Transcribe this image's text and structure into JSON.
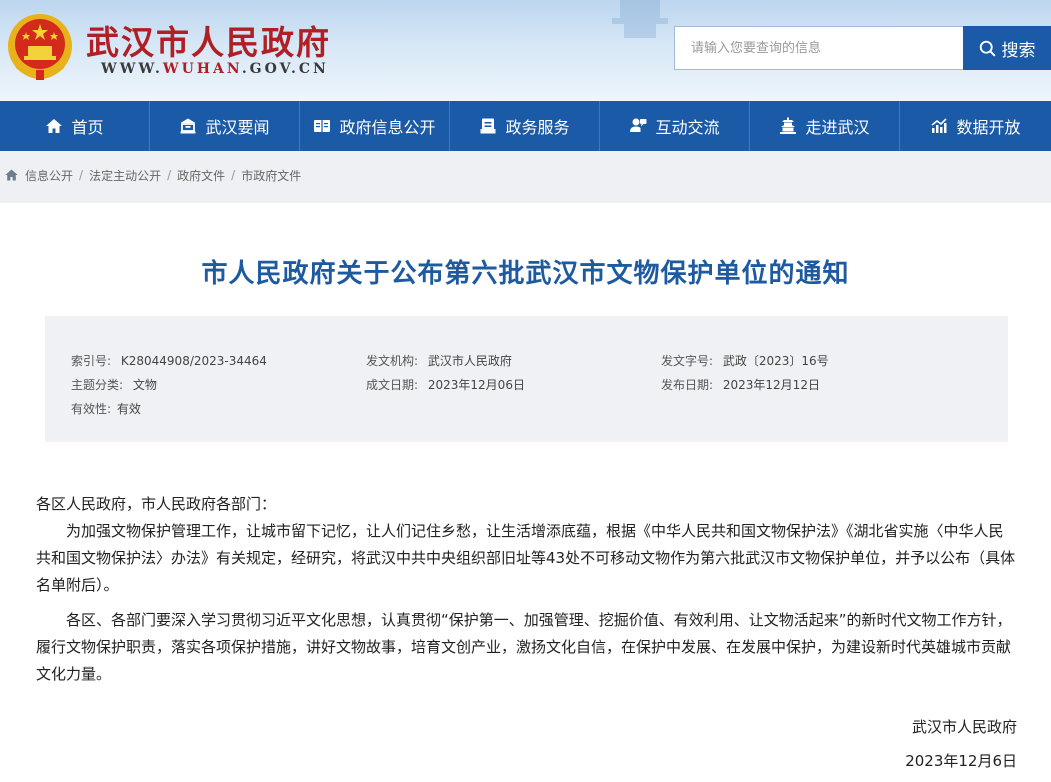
{
  "header": {
    "site_name": "武汉市人民政府",
    "url_prefix": "WWW.",
    "url_highlight": "WUHAN",
    "url_suffix": ".GOV.CN",
    "search_placeholder": "请输入您要查询的信息",
    "search_label": "搜索"
  },
  "nav": {
    "items": [
      {
        "label": "首页",
        "icon": "home-icon"
      },
      {
        "label": "武汉要闻",
        "icon": "building-icon"
      },
      {
        "label": "政府信息公开",
        "icon": "book-icon"
      },
      {
        "label": "政务服务",
        "icon": "document-icon"
      },
      {
        "label": "互动交流",
        "icon": "chat-icon"
      },
      {
        "label": "走进武汉",
        "icon": "landmark-icon"
      },
      {
        "label": "数据开放",
        "icon": "chart-icon"
      }
    ]
  },
  "breadcrumb": {
    "items": [
      "信息公开",
      "法定主动公开",
      "政府文件",
      "市政府文件"
    ],
    "separator": "/"
  },
  "article": {
    "title": "市人民政府关于公布第六批武汉市文物保护单位的通知",
    "meta": {
      "index_label": "索引号:",
      "index_value": "K28044908/2023-34464",
      "issuer_label": "发文机构:",
      "issuer_value": "武汉市人民政府",
      "docno_label": "发文字号:",
      "docno_value": "武政〔2023〕16号",
      "topic_label": "主题分类:",
      "topic_value": "文物",
      "created_label": "成文日期:",
      "created_value": "2023年12月06日",
      "published_label": "发布日期:",
      "published_value": "2023年12月12日",
      "validity_label": "有效性:",
      "validity_value": "有效"
    },
    "salutation": "各区人民政府，市人民政府各部门：",
    "paragraphs": [
      "为加强文物保护管理工作，让城市留下记忆，让人们记住乡愁，让生活增添底蕴，根据《中华人民共和国文物保护法》《湖北省实施〈中华人民共和国文物保护法〉办法》有关规定，经研究，将武汉中共中央组织部旧址等43处不可移动文物作为第六批武汉市文物保护单位，并予以公布（具体名单附后）。",
      "各区、各部门要深入学习贯彻习近平文化思想，认真贯彻“保护第一、加强管理、挖掘价值、有效利用、让文物活起来”的新时代文物工作方针，履行文物保护职责，落实各项保护措施，讲好文物故事，培育文创产业，激扬文化自信，在保护中发展、在发展中保护，为建设新时代英雄城市贡献文化力量。"
    ],
    "signature": "武汉市人民政府",
    "date": "2023年12月6日"
  },
  "colors": {
    "brand_red": "#b01f24",
    "nav_blue": "#1b5aa6",
    "title_blue": "#1e5aa0"
  }
}
